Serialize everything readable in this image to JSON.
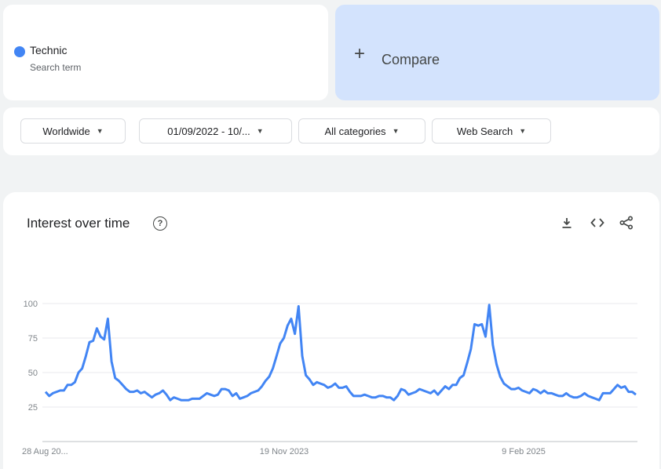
{
  "search_term": {
    "name": "Technic",
    "subtitle": "Search term",
    "color": "#4285f4"
  },
  "compare": {
    "plus": "+",
    "label": "Compare"
  },
  "filters": {
    "region": "Worldwide",
    "date_range": "01/09/2022 - 10/...",
    "category": "All categories",
    "search_type": "Web Search"
  },
  "chart_panel": {
    "title": "Interest over time",
    "help_icon": "?",
    "icons": [
      "download-icon",
      "embed-icon",
      "share-icon"
    ]
  },
  "chart_data": {
    "type": "line",
    "title": "Interest over time",
    "yticks": [
      25,
      50,
      75,
      100
    ],
    "ylim": [
      0,
      100
    ],
    "grid": true,
    "x_labels": [
      "28 Aug 20...",
      "19 Nov 2023",
      "9 Feb 2025"
    ],
    "series": [
      {
        "color": "#4285f4",
        "values": [
          36,
          33,
          35,
          36,
          37,
          37,
          41,
          41,
          43,
          50,
          53,
          62,
          72,
          73,
          82,
          76,
          74,
          89,
          58,
          46,
          44,
          41,
          38,
          36,
          36,
          37,
          35,
          36,
          34,
          32,
          34,
          35,
          37,
          34,
          30,
          32,
          31,
          30,
          30,
          30,
          31,
          31,
          31,
          33,
          35,
          34,
          33,
          34,
          38,
          38,
          37,
          33,
          35,
          31,
          32,
          33,
          35,
          36,
          37,
          40,
          44,
          47,
          53,
          62,
          71,
          75,
          84,
          89,
          78,
          98,
          62,
          48,
          45,
          41,
          43,
          42,
          41,
          39,
          40,
          42,
          39,
          39,
          40,
          36,
          33,
          33,
          33,
          34,
          33,
          32,
          32,
          33,
          33,
          32,
          32,
          30,
          33,
          38,
          37,
          34,
          35,
          36,
          38,
          37,
          36,
          35,
          37,
          34,
          37,
          40,
          38,
          41,
          41,
          46,
          48,
          57,
          67,
          85,
          84,
          85,
          76,
          99,
          70,
          56,
          47,
          42,
          40,
          38,
          38,
          39,
          37,
          36,
          35,
          38,
          37,
          35,
          37,
          35,
          35,
          34,
          33,
          33,
          35,
          33,
          32,
          32,
          33,
          35,
          33,
          32,
          31,
          30,
          35,
          35,
          35,
          38,
          41,
          39,
          40,
          36,
          36,
          34
        ]
      }
    ]
  }
}
